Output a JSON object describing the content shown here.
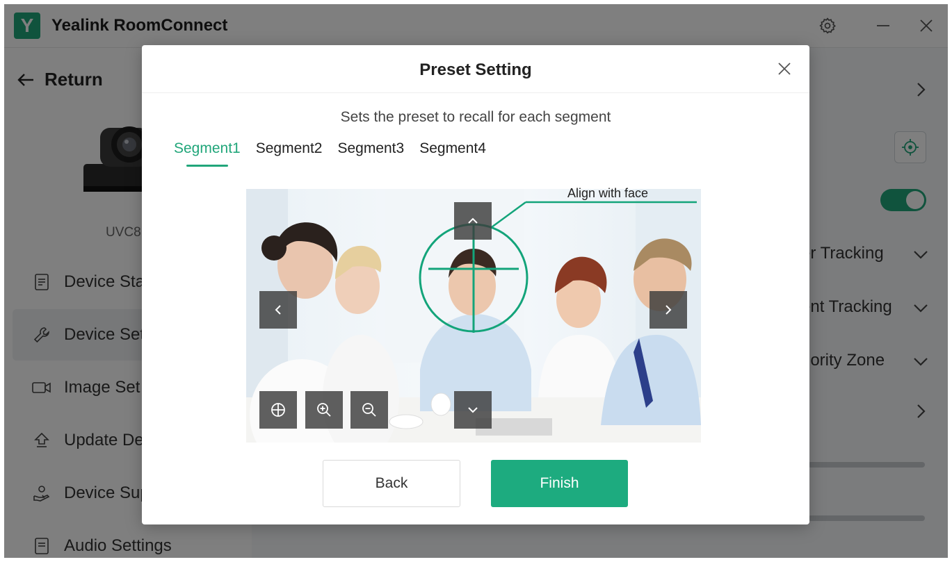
{
  "app": {
    "logo_letter": "Y",
    "title": "Yealink RoomConnect"
  },
  "sidebar": {
    "return_label": "Return",
    "device_model": "UVC8",
    "items": [
      {
        "label": "Device Sta",
        "icon": "document-icon"
      },
      {
        "label": "Device Set",
        "icon": "wrench-icon"
      },
      {
        "label": "Image Set",
        "icon": "video-camera-icon"
      },
      {
        "label": "Update De",
        "icon": "upgrade-icon"
      },
      {
        "label": "Device Sup",
        "icon": "support-icon"
      },
      {
        "label": "Audio Settings",
        "icon": "audio-icon"
      }
    ]
  },
  "right_panel": {
    "rows": [
      {
        "label": "er Tracking"
      },
      {
        "label": "ent Tracking"
      },
      {
        "label": "riority Zone"
      }
    ]
  },
  "modal": {
    "title": "Preset Setting",
    "subtitle": "Sets the preset to recall for each segment",
    "tabs": [
      {
        "label": "Segment1"
      },
      {
        "label": "Segment2"
      },
      {
        "label": "Segment3"
      },
      {
        "label": "Segment4"
      }
    ],
    "align_label": "Align with face",
    "back_label": "Back",
    "finish_label": "Finish"
  },
  "colors": {
    "accent": "#21a67a",
    "finish_button": "#1dab7f",
    "overlay": "rgba(0,0,0,0.5)"
  }
}
